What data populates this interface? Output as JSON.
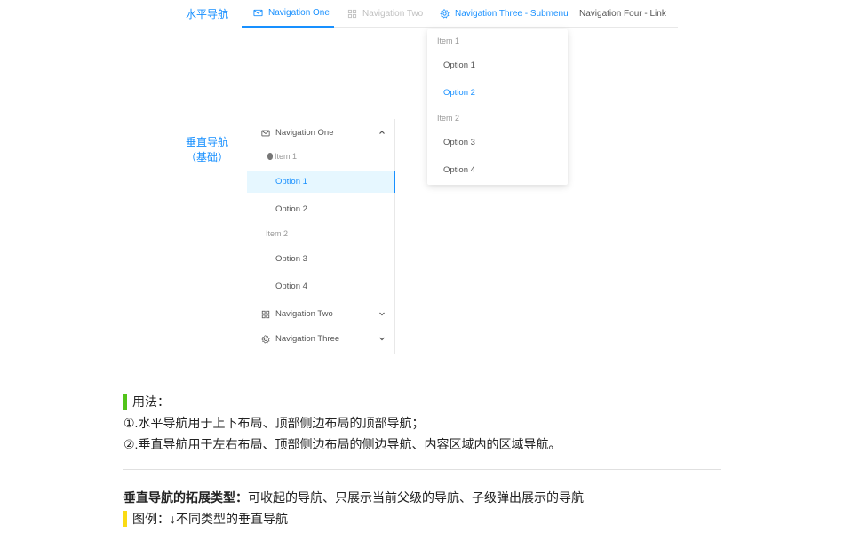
{
  "labels": {
    "horizontal": "水平导航",
    "vertical_line1": "垂直导航",
    "vertical_line2": "（基础）"
  },
  "horizontal_menu": {
    "items": [
      {
        "label": "Navigation One",
        "icon": "mail-icon",
        "state": "active"
      },
      {
        "label": "Navigation Two",
        "icon": "appstore-icon",
        "state": "disabled"
      },
      {
        "label": "Navigation Three - Submenu",
        "icon": "setting-icon",
        "state": "open"
      },
      {
        "label": "Navigation Four - Link",
        "state": "normal"
      }
    ],
    "dropdown": {
      "groups": [
        {
          "title": "Item 1",
          "options": [
            "Option 1",
            "Option 2"
          ]
        },
        {
          "title": "Item 2",
          "options": [
            "Option 3",
            "Option 4"
          ]
        }
      ],
      "selected": "Option 2"
    }
  },
  "vertical_menu": {
    "submenu_one": {
      "label": "Navigation One",
      "icon": "mail-icon",
      "expanded": true
    },
    "groups": [
      {
        "title": "Item 1",
        "options": [
          "Option 1",
          "Option 2"
        ]
      },
      {
        "title": "Item 2",
        "options": [
          "Option 3",
          "Option 4"
        ]
      }
    ],
    "selected": "Option 1",
    "submenu_two": {
      "label": "Navigation Two",
      "icon": "appstore-icon"
    },
    "submenu_three": {
      "label": "Navigation Three",
      "icon": "setting-icon"
    }
  },
  "usage": {
    "title": "用法：",
    "line1": "①.水平导航用于上下布局、顶部侧边布局的顶部导航；",
    "line2": "②.垂直导航用于左右布局、顶部侧边布局的侧边导航、内容区域内的区域导航。"
  },
  "extension": {
    "title": "垂直导航的拓展类型：",
    "text": "可收起的导航、只展示当前父级的导航、子级弹出展示的导航"
  },
  "legend": {
    "text": "图例：↓不同类型的垂直导航"
  },
  "colors": {
    "primary": "#1890ff",
    "selected_bg": "#e6f7ff",
    "usage_bar": "#52c41a",
    "legend_bar": "#fadb14"
  }
}
